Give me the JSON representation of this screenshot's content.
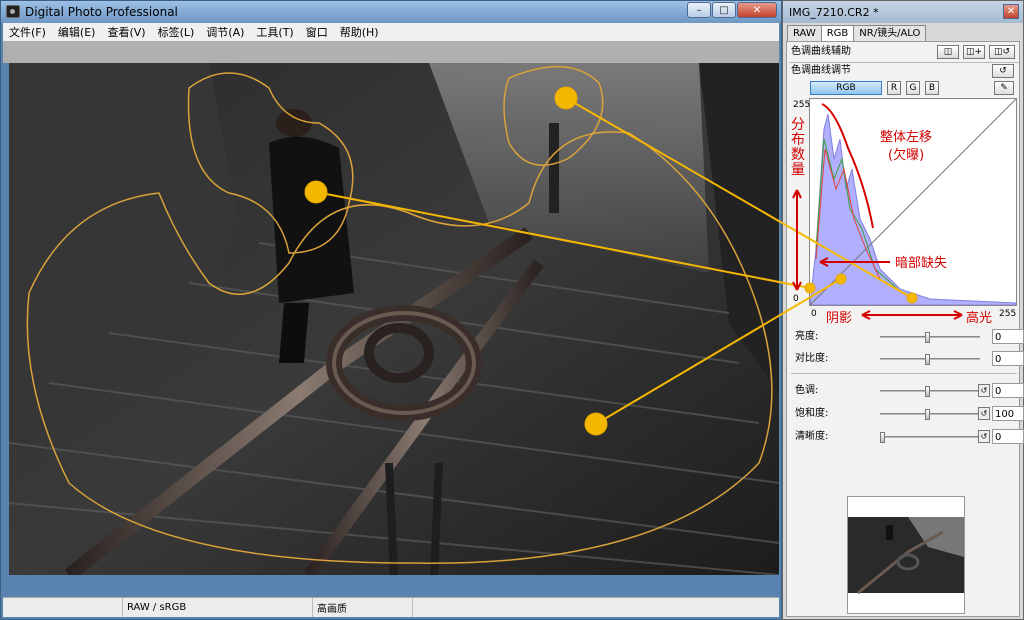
{
  "main_window": {
    "title": "Digital Photo Professional",
    "menu": [
      "文件(F)",
      "编辑(E)",
      "查看(V)",
      "标签(L)",
      "调节(A)",
      "工具(T)",
      "窗口",
      "帮助(H)"
    ],
    "buttons": {
      "minimize": "–",
      "maximize": "□",
      "close": "✕"
    },
    "status": {
      "color_space": "RAW / sRGB",
      "quality": "高画质"
    }
  },
  "panel": {
    "title": "IMG_7210.CR2 *",
    "close": "✕",
    "tabs": [
      "RAW",
      "RGB",
      "NR/镜头/ALO"
    ],
    "curve_assist": "色调曲线辅助",
    "curve_adjust": "色调曲线调节",
    "channels": {
      "rgb": "RGB",
      "r": "R",
      "g": "G",
      "b": "B"
    },
    "graph": {
      "top": "255",
      "left": "0",
      "bottom_left": "0",
      "bottom_right": "255"
    },
    "sliders": [
      {
        "label": "亮度:",
        "value": "0"
      },
      {
        "label": "对比度:",
        "value": "0"
      },
      {
        "label": "色调:",
        "value": "0"
      },
      {
        "label": "饱和度:",
        "value": "100"
      },
      {
        "label": "清晰度:",
        "value": "0"
      }
    ]
  },
  "annotations": {
    "dist": "分布数量",
    "shift": "整体左移",
    "under": "(欠曝)",
    "dark_loss": "暗部缺失",
    "shadow": "阴影",
    "highlight": "高光"
  },
  "colors": {
    "annotation": "#d40000",
    "marker": "#f5b800"
  }
}
